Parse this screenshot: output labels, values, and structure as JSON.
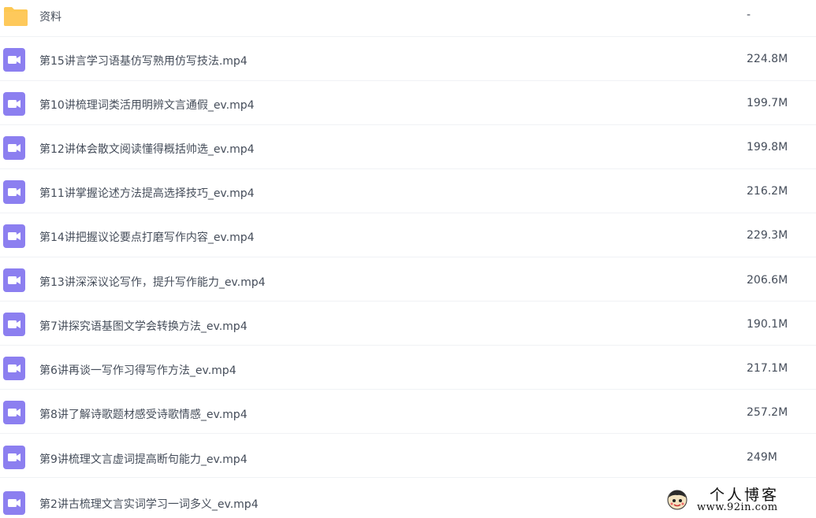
{
  "files": [
    {
      "name": "资料",
      "size": "-",
      "icon": "folder-icon"
    },
    {
      "name": "第15讲言学习语基仿写熟用仿写技法.mp4",
      "size": "224.8M",
      "icon": "video-file-icon"
    },
    {
      "name": "第10讲梳理词类活用明辨文言通假_ev.mp4",
      "size": "199.7M",
      "icon": "video-file-icon"
    },
    {
      "name": "第12讲体会散文阅读懂得概括帅选_ev.mp4",
      "size": "199.8M",
      "icon": "video-file-icon"
    },
    {
      "name": "第11讲掌握论述方法提高选择技巧_ev.mp4",
      "size": "216.2M",
      "icon": "video-file-icon"
    },
    {
      "name": "第14讲把握议论要点打磨写作内容_ev.mp4",
      "size": "229.3M",
      "icon": "video-file-icon"
    },
    {
      "name": "第13讲深深议论写作，提升写作能力_ev.mp4",
      "size": "206.6M",
      "icon": "video-file-icon"
    },
    {
      "name": "第7讲探究语基图文学会转换方法_ev.mp4",
      "size": "190.1M",
      "icon": "video-file-icon"
    },
    {
      "name": "第6讲再谈一写作习得写作方法_ev.mp4",
      "size": "217.1M",
      "icon": "video-file-icon"
    },
    {
      "name": "第8讲了解诗歌题材感受诗歌情感_ev.mp4",
      "size": "257.2M",
      "icon": "video-file-icon"
    },
    {
      "name": "第9讲梳理文言虚词提高断句能力_ev.mp4",
      "size": "249M",
      "icon": "video-file-icon"
    },
    {
      "name": "第2讲古梳理文言实词学习一词多义_ev.mp4",
      "size": "",
      "icon": "video-file-icon"
    }
  ],
  "watermark": {
    "title": "个人博客",
    "url": "www.92in.com"
  },
  "colors": {
    "folder": "#fdc853",
    "video": "#8c7ff0",
    "text": "#454d5a",
    "divider": "#f0f2f5"
  }
}
